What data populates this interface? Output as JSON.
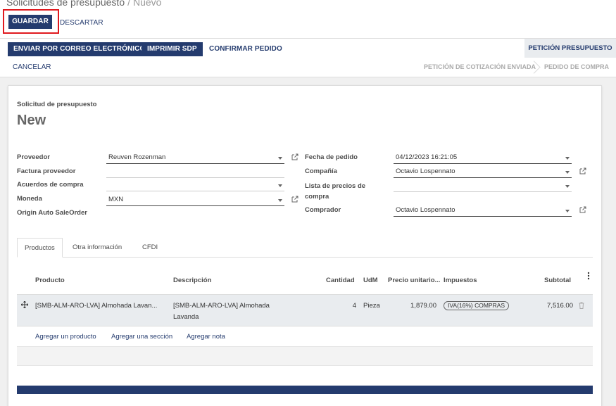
{
  "breadcrumb": {
    "parent": "Solicitudes de presupuesto",
    "separator": "/",
    "current": "Nuevo"
  },
  "actions": {
    "save_label": "GUARDAR",
    "discard_label": "DESCARTAR"
  },
  "statusbar": {
    "email_label": "ENVIAR POR CORREO ELECTRÓNICO",
    "print_label": "IMPRIMIR SDP",
    "confirm_label": "CONFIRMAR PEDIDO",
    "cancel_label": "CANCELAR",
    "states": [
      "PETICIÓN PRESUPUESTO",
      "PETICIÓN DE COTIZACIÓN ENVIADA",
      "PEDIDO DE COMPRA"
    ],
    "active_state": "PETICIÓN PRESUPUESTO"
  },
  "form": {
    "doc_label": "Solicitud de presupuesto",
    "doc_name": "New",
    "left_fields": [
      {
        "label": "Proveedor",
        "value": "Reuven Rozenman"
      },
      {
        "label": "Factura proveedor",
        "value": ""
      },
      {
        "label": "Acuerdos de compra",
        "value": ""
      },
      {
        "label": "Moneda",
        "value": "MXN"
      },
      {
        "label": "Origin Auto SaleOrder",
        "value": ""
      }
    ],
    "right_fields": [
      {
        "label": "Fecha de pedido",
        "value": "04/12/2023 16:21:05"
      },
      {
        "label": "Compañía",
        "value": "Octavio Lospennato"
      },
      {
        "label": "Lista de precios de compra",
        "value": ""
      },
      {
        "label": "Comprador",
        "value": "Octavio Lospennato"
      }
    ]
  },
  "tabs": [
    "Productos",
    "Otra información",
    "CFDI"
  ],
  "active_tab": "Productos",
  "lines": {
    "columns": [
      "Producto",
      "Descripción",
      "Cantidad",
      "UdM",
      "Precio unitario...",
      "Impuestos",
      "Subtotal"
    ],
    "rows": [
      {
        "product": "[SMB-ALM-ARO-LVA] Almohada Lavan...",
        "description_1": "[SMB-ALM-ARO-LVA] Almohada",
        "description_2": "Lavanda",
        "quantity": "4",
        "uom": "Pieza",
        "unit_price": "1,879.00",
        "taxes": "IVA(16%) COMPRAS",
        "subtotal": "7,516.00"
      }
    ],
    "add_product": "Agregar un producto",
    "add_section": "Agregar una sección",
    "add_note": "Agregar nota"
  },
  "colors": {
    "primary": "#243b6e",
    "highlight": "#e0191e"
  },
  "icons": [
    "caret-down-icon",
    "external-link-icon",
    "drag-handle-icon",
    "trash-icon",
    "kebab-menu-icon"
  ]
}
